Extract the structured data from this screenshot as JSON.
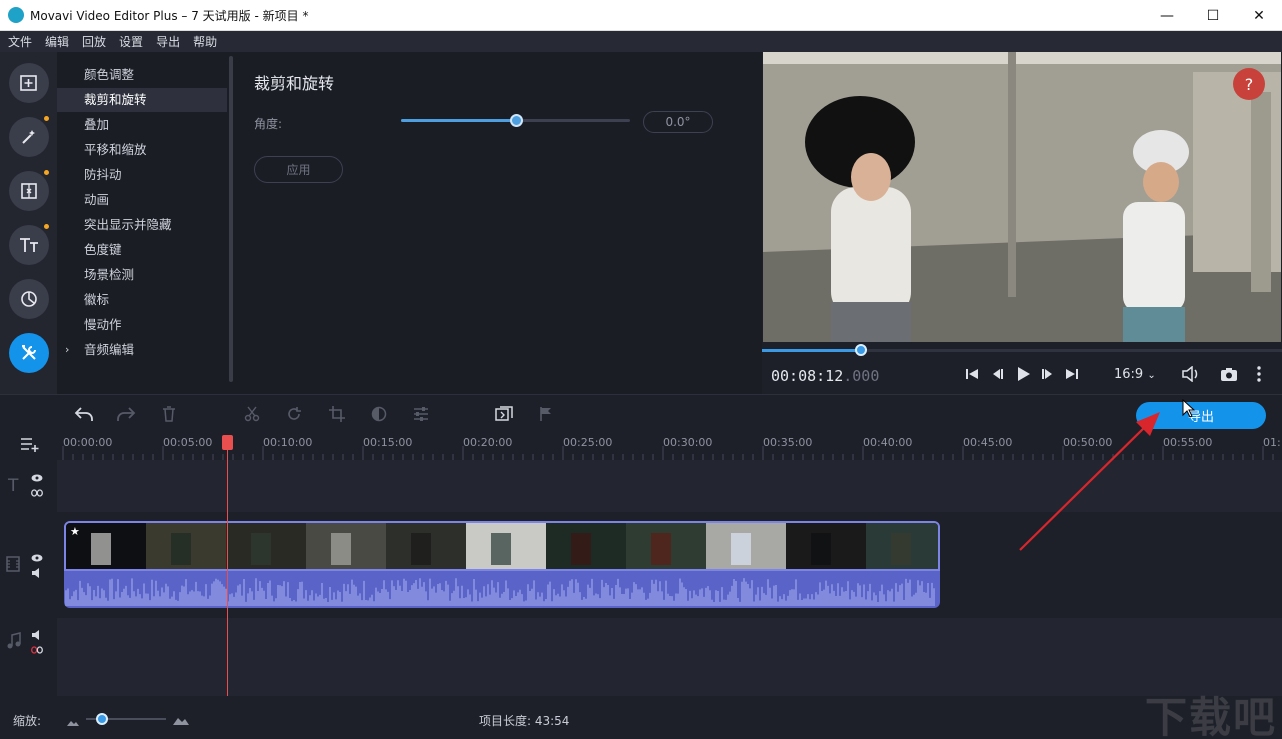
{
  "window": {
    "title": "Movavi Video Editor Plus – 7 天试用版 - 新项目 *",
    "minimize": "—",
    "maximize": "☐",
    "close": "✕"
  },
  "menu": [
    "文件",
    "编辑",
    "回放",
    "设置",
    "导出",
    "帮助"
  ],
  "categories": [
    {
      "label": "颜色调整"
    },
    {
      "label": "裁剪和旋转"
    },
    {
      "label": "叠加"
    },
    {
      "label": "平移和缩放"
    },
    {
      "label": "防抖动"
    },
    {
      "label": "动画"
    },
    {
      "label": "突出显示并隐藏"
    },
    {
      "label": "色度键"
    },
    {
      "label": "场景检测"
    },
    {
      "label": "徽标"
    },
    {
      "label": "慢动作"
    },
    {
      "label": "音频编辑"
    }
  ],
  "active_category": "裁剪和旋转",
  "panel": {
    "title": "裁剪和旋转",
    "angle_label": "角度:",
    "angle_value": "0.0°",
    "angle_slider_level": 0.5,
    "apply_label": "应用"
  },
  "preview": {
    "help": "?",
    "time_main": "00:08:12",
    "time_ms": ".000",
    "aspect": "16:9",
    "progress": 0.19
  },
  "timeline": {
    "export_label": "导出",
    "ticks": [
      "00:00:00",
      "00:05:00",
      "00:10:00",
      "00:15:00",
      "00:20:00",
      "00:25:00",
      "00:30:00",
      "00:35:00",
      "00:40:00",
      "00:45:00",
      "00:50:00",
      "00:55:00",
      "01:"
    ]
  },
  "bottom": {
    "zoom_label": "缩放:",
    "project_length": "项目长度: 43:54",
    "zoom_level": 0.2
  },
  "watermark": "下载吧",
  "colors": {
    "accent": "#1493ea",
    "playhead": "#e94f4f",
    "audio_wave": "#5a64c8",
    "video_track_border": "#7c84e6",
    "annotation_arrow": "#d9262c"
  }
}
